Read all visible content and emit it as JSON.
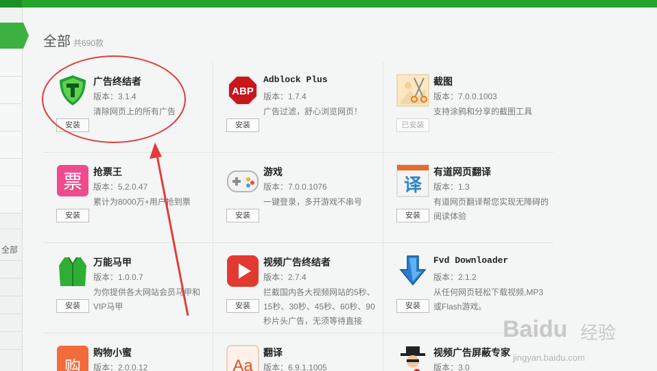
{
  "header": {
    "title": "全部",
    "count": "共690款"
  },
  "sidebar": {
    "label": "全部"
  },
  "apps": [
    {
      "name": "广告终结者",
      "version": "版本：3.1.4",
      "desc": "清除网页上的所有广告",
      "button": "安装",
      "icon": "shield-t-icon"
    },
    {
      "name": "Adblock Plus",
      "version": "版本：1.7.4",
      "desc": "广告过滤，舒心浏览网页！",
      "button": "安装",
      "icon": "abp-stop-sign-icon"
    },
    {
      "name": "截图",
      "version": "版本：7.0.0.1003",
      "desc": "支持涂鸦和分享的截图工具",
      "button": "已安装",
      "icon": "scissors-icon"
    },
    {
      "name": "抢票王",
      "version": "版本：5.2.0.47",
      "desc": "累计为8000万+用户抢到票",
      "button": "安装",
      "icon": "ticket-icon"
    },
    {
      "name": "游戏",
      "version": "版本：7.0.0.1076",
      "desc": "一键登录，多开游戏不串号",
      "button": "安装",
      "icon": "gamepad-icon"
    },
    {
      "name": "有道网页翻译",
      "version": "版本：1.3",
      "desc": "有道网页翻译帮您实现无障碍的阅读体验",
      "button": "安装",
      "icon": "translate-yi-icon"
    },
    {
      "name": "万能马甲",
      "version": "版本：1.0.0.7",
      "desc": "为你提供各大网站会员马甲和VIP马甲",
      "button": "安装",
      "icon": "vest-icon"
    },
    {
      "name": "视频广告终结者",
      "version": "版本：2.7.4",
      "desc": "拦截国内各大视频网站的5秒、15秒、30秒、45秒、60秒、90秒片头广告，无须等待直接",
      "button": "安装",
      "icon": "video-play-icon"
    },
    {
      "name": "Fvd Downloader",
      "version": "版本：2.1.2",
      "desc": "从任何网页轻松下载视频,MP3或Flash游戏。",
      "button": "安装",
      "icon": "download-arrow-icon"
    },
    {
      "name": "购物小蜜",
      "version": "版本：2.0.0.12",
      "desc": "",
      "button": "",
      "icon": "shopping-bag-icon"
    },
    {
      "name": "翻译",
      "version": "版本：6.9.1.1005",
      "desc": "",
      "button": "",
      "icon": "aa-translate-icon"
    },
    {
      "name": "视频广告屏蔽专家",
      "version": "版本：3.0",
      "desc": "",
      "button": "",
      "icon": "hat-man-icon"
    }
  ],
  "watermark": {
    "brand": "Baidu",
    "brand_cn": "经验",
    "url": "jingyan.baidu.com"
  },
  "colors": {
    "accent": "#22a52a",
    "annotation": "#e23b3b"
  }
}
